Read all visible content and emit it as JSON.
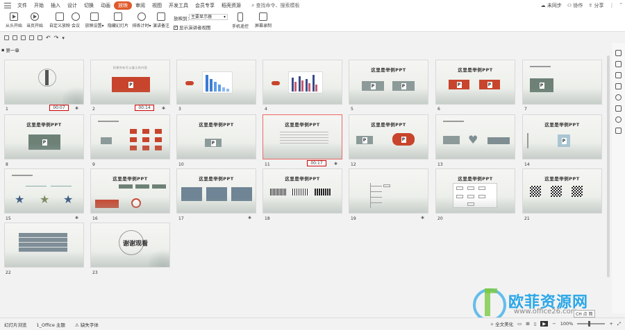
{
  "menu": {
    "items": [
      "文件",
      "开始",
      "插入",
      "设计",
      "切换",
      "动画",
      "放映",
      "审阅",
      "视图",
      "开发工具",
      "会员专享",
      "稻壳资源"
    ],
    "active_index": 6,
    "search": "查找命令、搜索模板"
  },
  "header_right": {
    "sync": "未同步",
    "collab": "协作",
    "share": "分享"
  },
  "toolbar": {
    "from_start": "从头开始",
    "from_current": "当页开始",
    "custom_show": "自定义放映",
    "meeting": "会议",
    "show_settings": "放映设置",
    "hide_slide": "隐藏幻灯片",
    "rehearse": "排练计时",
    "speaker_notes": "演讲备注",
    "display_label": "放映到：",
    "display_value": "主要显示器",
    "presenter_view": "显示演讲者视图",
    "phone_remote": "手机遥控",
    "screen_record": "屏幕录制"
  },
  "section_name": "第一章",
  "slides": [
    {
      "num": "1",
      "timing": "00:07",
      "star": true
    },
    {
      "num": "2",
      "timing": "00:14",
      "star": true
    },
    {
      "num": "3"
    },
    {
      "num": "4"
    },
    {
      "num": "5"
    },
    {
      "num": "6"
    },
    {
      "num": "7"
    },
    {
      "num": "8"
    },
    {
      "num": "9"
    },
    {
      "num": "10"
    },
    {
      "num": "11",
      "timing": "00:17",
      "star": true
    },
    {
      "num": "12"
    },
    {
      "num": "13"
    },
    {
      "num": "14"
    },
    {
      "num": "15",
      "star": true
    },
    {
      "num": "16"
    },
    {
      "num": "17",
      "star": true
    },
    {
      "num": "18"
    },
    {
      "num": "19",
      "star": true
    },
    {
      "num": "20"
    },
    {
      "num": "21"
    },
    {
      "num": "22"
    },
    {
      "num": "23"
    }
  ],
  "slide_titles": {
    "main": "这里是举例PPT",
    "ending": "谢谢观看",
    "slide2": "如果你有可以展示的内容"
  },
  "status": {
    "slide_browse": "幻灯片浏览",
    "theme": "1_Office 主题",
    "missing_font": "缺失字体",
    "beautify": "全文美化",
    "zoom": "100%",
    "ime": "CH 点 简"
  },
  "watermark": {
    "text": "欧菲资源网",
    "url": "www.office26.com"
  },
  "colors": {
    "accent": "#e05a2b",
    "selected_border": "#e66",
    "timing_border": "#c00"
  }
}
